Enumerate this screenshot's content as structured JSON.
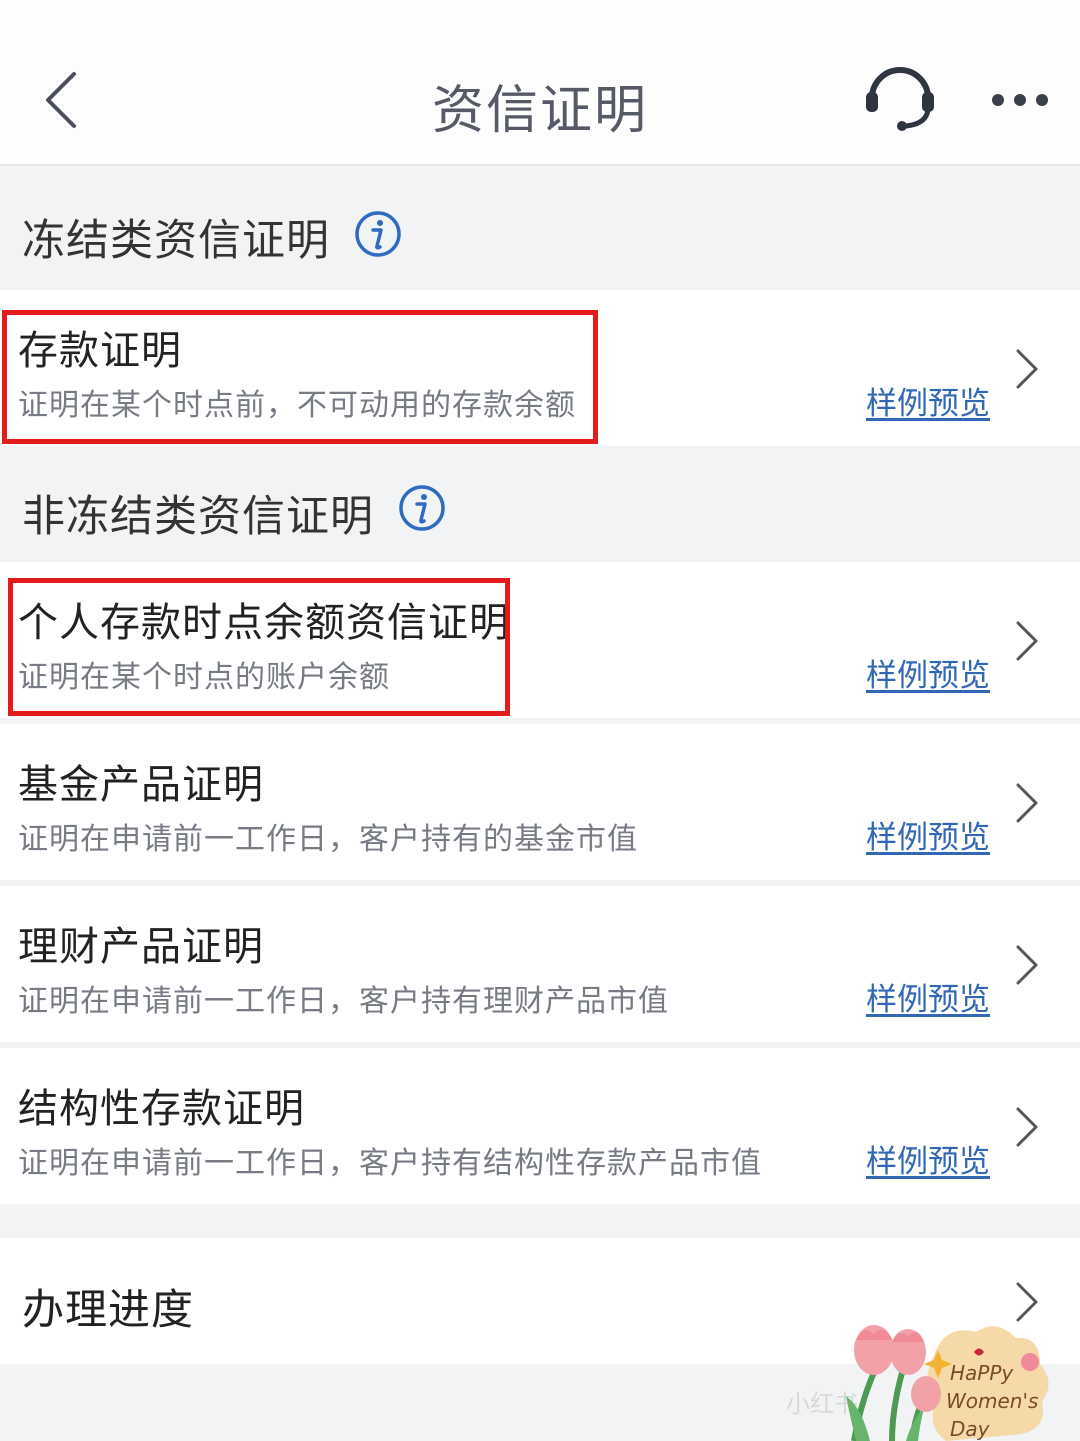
{
  "header": {
    "title": "资信证明",
    "back_icon": "chevron-left-icon",
    "support_icon": "headset-icon",
    "more_icon": "more-dots-icon"
  },
  "sections": {
    "frozen": {
      "title": "冻结类资信证明",
      "info_icon": "info-icon"
    },
    "non_frozen": {
      "title": "非冻结类资信证明",
      "info_icon": "info-icon"
    }
  },
  "items": [
    {
      "title": "存款证明",
      "desc": "证明在某个时点前，不可动用的存款余额",
      "link": "样例预览",
      "highlighted": true
    },
    {
      "title": "个人存款时点余额资信证明",
      "desc": "证明在某个时点的账户余额",
      "link": "样例预览",
      "highlighted": true
    },
    {
      "title": "基金产品证明",
      "desc": "证明在申请前一工作日，客户持有的基金市值",
      "link": "样例预览",
      "highlighted": false
    },
    {
      "title": "理财产品证明",
      "desc": "证明在申请前一工作日，客户持有理财产品市值",
      "link": "样例预览",
      "highlighted": false
    },
    {
      "title": "结构性存款证明",
      "desc": "证明在申请前一工作日，客户持有结构性存款产品市值",
      "link": "样例预览",
      "highlighted": false
    }
  ],
  "progress_row": {
    "label": "办理进度"
  },
  "sticker": {
    "text_line1": "HaPPy",
    "text_line2": "Women's",
    "text_line3": "Day"
  },
  "watermark": "小红书",
  "colors": {
    "link": "#3167b4",
    "highlight_border": "#e31b1b",
    "background": "#f2f3f5",
    "card": "#ffffff",
    "icon_blue": "#2f6bc1"
  }
}
